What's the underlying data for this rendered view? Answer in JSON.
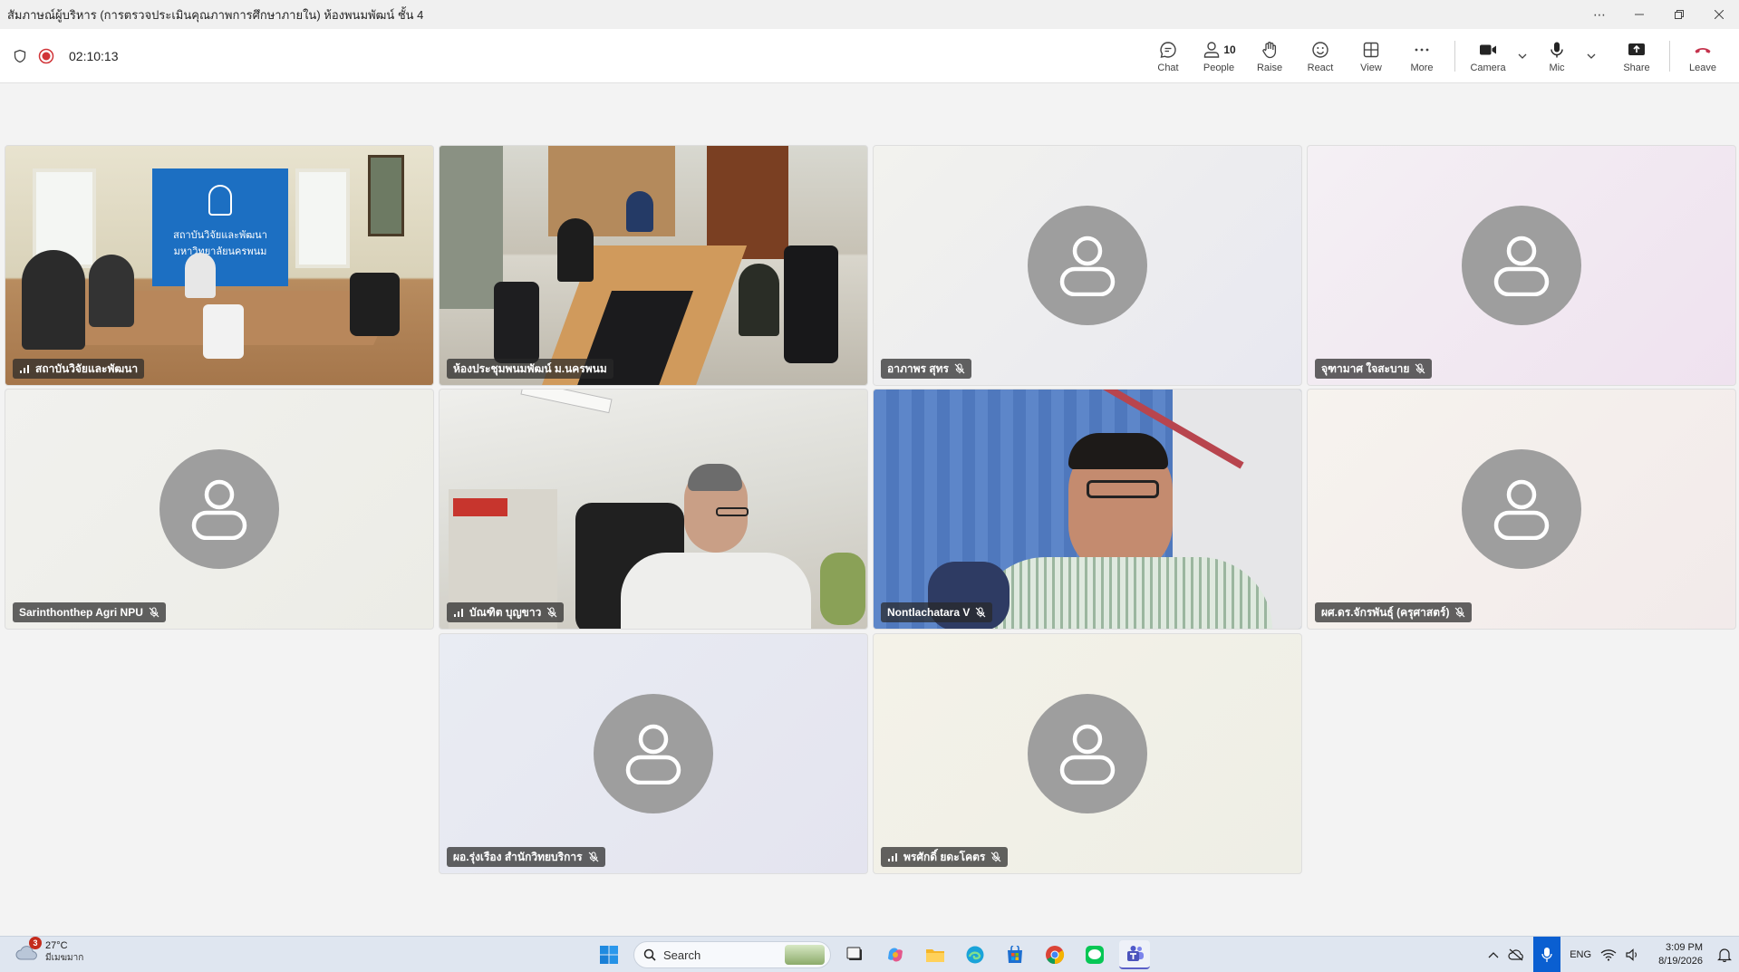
{
  "window": {
    "title": "สัมภาษณ์ผู้บริหาร (การตรวจประเมินคุณภาพการศึกษาภายใน) ห้องพนมพัฒน์ ชั้น 4"
  },
  "meeting": {
    "elapsed": "02:10:13",
    "controls": {
      "chat": "Chat",
      "people": "People",
      "people_count": "10",
      "raise": "Raise",
      "react": "React",
      "view": "View",
      "more": "More",
      "camera": "Camera",
      "mic": "Mic",
      "share": "Share",
      "leave": "Leave"
    }
  },
  "participants": [
    "สถาบันวิจัยและพัฒนา",
    "ห้องประชุมพนมพัฒน์ ม.นครพนม",
    "อาภาพร สุทร",
    "จุฑามาศ ใจสะบาย",
    "Sarinthonthep Agri NPU",
    "บัณฑิต บุญขาว",
    "Nontlachatara V",
    "ผศ.ดร.จักรพันธุ์ (ครุศาสตร์)",
    "ผอ.รุ่งเรือง สำนักวิทยบริการ",
    "พรศักดิ์ ยดะโคตร"
  ],
  "banner": {
    "line1": "สถาบันวิจัยและพัฒนา",
    "line2": "มหาวิทยาลัยนครพนม"
  },
  "taskbar": {
    "weather_temp": "27°C",
    "weather_cond": "มีเมฆมาก",
    "weather_badge": "3",
    "search_placeholder": "Search",
    "language": "ENG",
    "time": "3:09 PM",
    "date": "8/19/2026"
  },
  "colors": {
    "leave_red": "#c4314b",
    "record_red": "#d13438",
    "placeholder_avatar": "#9e9e9e"
  }
}
